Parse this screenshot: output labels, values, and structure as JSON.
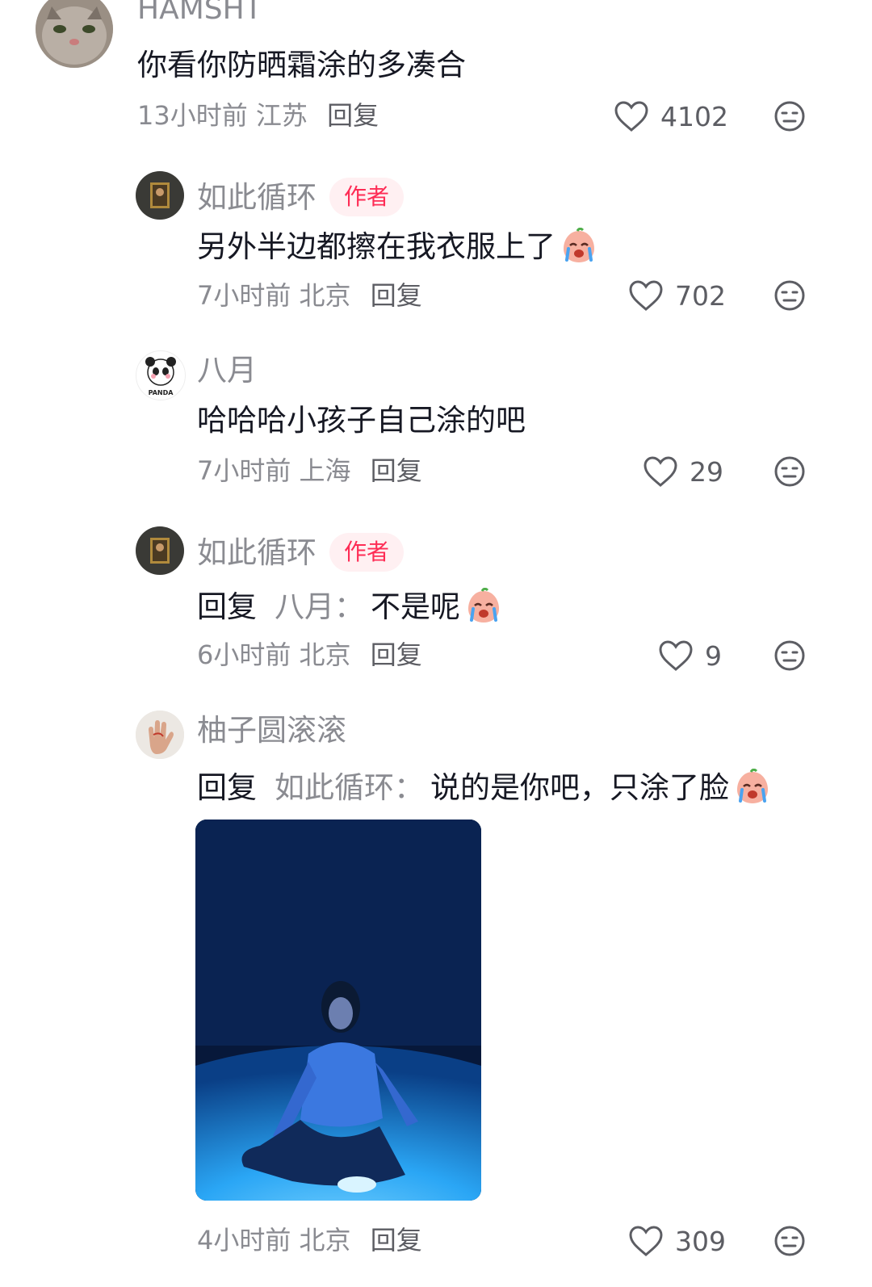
{
  "comments": [
    {
      "name": "HAMSHT",
      "text": "你看你防晒霜涂的多凑合",
      "time": "13小时前",
      "location": "江苏",
      "reply_label": "回复",
      "likes": "4102"
    },
    {
      "name": "如此循环",
      "badge": "作者",
      "text": "另外半边都擦在我衣服上了",
      "time": "7小时前",
      "location": "北京",
      "reply_label": "回复",
      "likes": "702"
    },
    {
      "name": "八月",
      "text": "哈哈哈小孩子自己涂的吧",
      "time": "7小时前",
      "location": "上海",
      "reply_label": "回复",
      "likes": "29"
    },
    {
      "name": "如此循环",
      "badge": "作者",
      "reply_prefix": "回复",
      "reply_target": "八月：",
      "text": "不是呢",
      "time": "6小时前",
      "location": "北京",
      "reply_label": "回复",
      "likes": "9"
    },
    {
      "name": "柚子圆滚滚",
      "reply_prefix": "回复",
      "reply_target": "如此循环：",
      "text": "说的是你吧，只涂了脸",
      "time": "4小时前",
      "location": "北京",
      "reply_label": "回复",
      "likes": "309"
    }
  ],
  "avatar_badge_text": "PANDA",
  "icons": {
    "like": "heart-outline-icon",
    "dislike": "neutral-face-icon",
    "emoji": "crying-face-emoji"
  },
  "colors": {
    "author_badge_bg": "#fff0f2",
    "author_badge_text": "#fe2c55",
    "muted": "#8a8b91"
  }
}
